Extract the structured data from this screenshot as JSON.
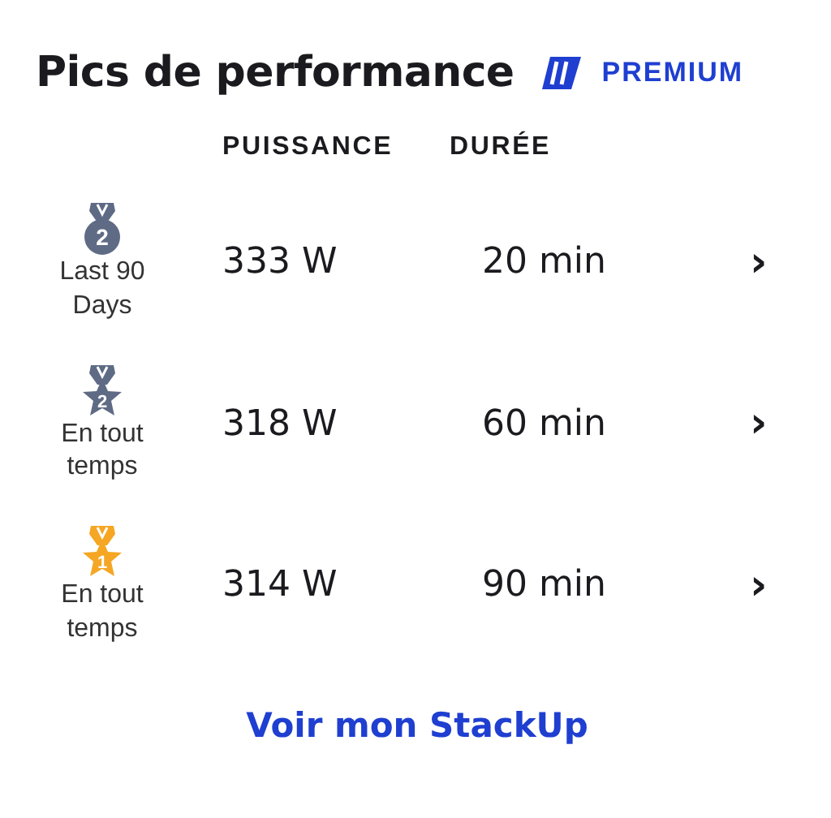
{
  "title": "Pics de performance",
  "badge": {
    "label": "PREMIUM"
  },
  "columns": [
    "PUISSANCE",
    "DURÉE"
  ],
  "rows": [
    {
      "medal": {
        "kind": "circle",
        "rank": "2",
        "color": "#5f6b85"
      },
      "period": "Last 90 Days",
      "power": "333 W",
      "duration": "20 min",
      "chevron": "›"
    },
    {
      "medal": {
        "kind": "star",
        "rank": "2",
        "color": "#5f6b85"
      },
      "period": "En tout temps",
      "power": "318 W",
      "duration": "60 min",
      "chevron": "›"
    },
    {
      "medal": {
        "kind": "star",
        "rank": "1",
        "color": "#f5a623"
      },
      "period": "En tout temps",
      "power": "314 W",
      "duration": "90 min",
      "chevron": "›"
    }
  ],
  "link": "Voir mon StackUp"
}
